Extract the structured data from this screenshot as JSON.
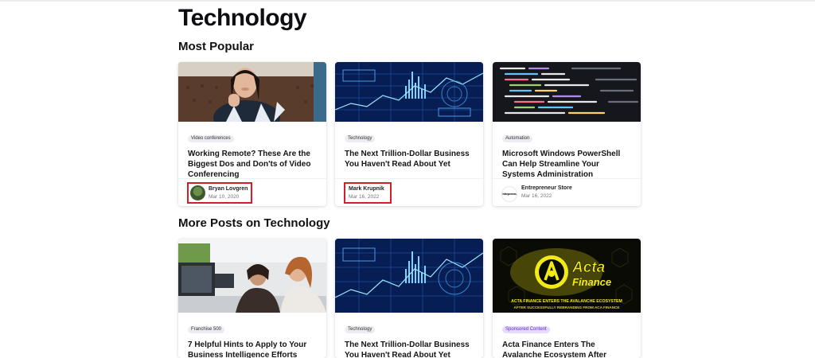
{
  "page": {
    "title": "Technology"
  },
  "sections": {
    "most_popular": "Most Popular",
    "more_posts": "More Posts on Technology"
  },
  "popular": [
    {
      "tag": "Video conferences",
      "title": "Working Remote? These Are the Biggest Dos and Don'ts of Video Conferencing",
      "author": "Bryan Lovgren",
      "date": "Mar 10, 2020",
      "image": "woman-on-video-call"
    },
    {
      "tag": "Technology",
      "title": "The Next Trillion-Dollar Business You Haven't Read About Yet",
      "author": "Mark Krupnik",
      "date": "Mar 16, 2022",
      "image": "blue-data-charts"
    },
    {
      "tag": "Automation",
      "title": "Microsoft Windows PowerShell Can Help Streamline Your Systems Administration",
      "author": "Entrepreneur Store",
      "date": "Mar 16, 2022",
      "logo_text": "Entrepreneur",
      "image": "code-on-screen"
    }
  ],
  "more": [
    {
      "tag": "Franchise 500",
      "title": "7 Helpful Hints to Apply to Your Business Intelligence Efforts",
      "image": "office-team-at-computer"
    },
    {
      "tag": "Technology",
      "title": "The Next Trillion-Dollar Business You Haven't Read About Yet",
      "image": "blue-data-charts"
    },
    {
      "tag": "Sponsored Content",
      "title": "Acta Finance Enters The Avalanche Ecosystem After Successfully",
      "image": "acta-finance-banner",
      "banner_brand_line1": "Acta",
      "banner_brand_line2": "Finance",
      "banner_caption_line1": "ACTA FINANCE ENTERS THE AVALANCHE ECOSYSTEM",
      "banner_caption_line2": "AFTER SUCCESSFULLY REBRANDING FROM ACA FINANCE"
    }
  ],
  "colors": {
    "highlight_box": "#d41f26",
    "sponsored_tag_bg": "#e7dcfd",
    "banner_yellow": "#e8e015"
  }
}
